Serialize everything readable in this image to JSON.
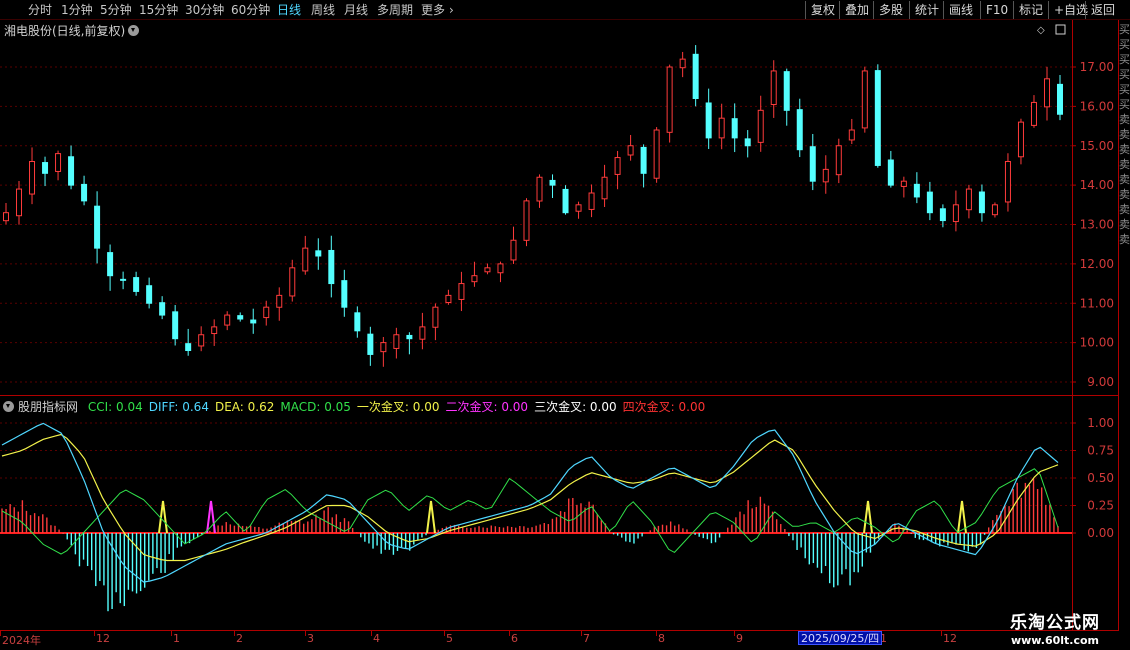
{
  "toolbar": {
    "periods": [
      "分时",
      "1分钟",
      "5分钟",
      "15分钟",
      "30分钟",
      "60分钟",
      "日线",
      "周线",
      "月线",
      "多周期",
      "更多"
    ],
    "active_period": "日线",
    "right_buttons": [
      "复权",
      "叠加",
      "多股",
      "统计",
      "画线",
      "F10",
      "标记",
      "+自选",
      "返回"
    ]
  },
  "stock": {
    "title": "湘电股份(日线,前复权)"
  },
  "price_axis": {
    "ticks": [
      "17.00",
      "16.00",
      "15.00",
      "14.00",
      "13.00",
      "12.00",
      "11.00",
      "10.00",
      "9.00"
    ],
    "values": [
      17,
      16,
      15,
      14,
      13,
      12,
      11,
      10,
      9
    ]
  },
  "indicator": {
    "name": "股朋指标网",
    "items": [
      {
        "label": "CCI: 0.04",
        "color": "#31e04a"
      },
      {
        "label": "DIFF: 0.64",
        "color": "#4fd7ff"
      },
      {
        "label": "DEA: 0.62",
        "color": "#f2f24a"
      },
      {
        "label": "MACD: 0.05",
        "color": "#31e04a"
      },
      {
        "label": "一次金叉: 0.00",
        "color": "#f2f24a"
      },
      {
        "label": "二次金叉: 0.00",
        "color": "#ff33ff"
      },
      {
        "label": "三次金叉: 0.00",
        "color": "#ffffff"
      },
      {
        "label": "四次金叉: 0.00",
        "color": "#ff3333"
      }
    ],
    "ticks": [
      "1.00",
      "0.75",
      "0.50",
      "0.25",
      "0.00"
    ],
    "values": [
      1.0,
      0.75,
      0.5,
      0.25,
      0.0
    ]
  },
  "date_axis": {
    "labels": [
      "2024年",
      "12",
      "1",
      "2",
      "3",
      "4",
      "5",
      "6",
      "7",
      "8",
      "9",
      "1",
      "12"
    ],
    "selected_date": "2025/09/25/四"
  },
  "right_panel": {
    "text": "买买买买买买卖卖卖卖卖卖卖卖卖"
  },
  "watermark": {
    "title": "乐淘公式网",
    "url": "www.60lt.com"
  },
  "colors": {
    "up": "#ff3b3b",
    "down": "#54ffff",
    "axis": "#b00000",
    "grid": "#5a0000",
    "diff": "#4fd7ff",
    "dea": "#f2f24a",
    "cci": "#31e04a"
  },
  "chart_data": [
    {
      "type": "candlestick",
      "title": "湘电股份(日线,前复权)",
      "ylim": [
        9,
        17.5
      ],
      "close_series": [
        13.3,
        13.9,
        14.6,
        14.3,
        14.8,
        14.0,
        13.6,
        12.4,
        11.7,
        11.6,
        11.3,
        11.0,
        10.7,
        10.1,
        9.8,
        10.2,
        10.4,
        10.7,
        10.6,
        10.5,
        10.9,
        11.2,
        11.9,
        12.4,
        12.2,
        11.5,
        10.9,
        10.3,
        9.7,
        10.0,
        10.2,
        10.1,
        10.4,
        10.9,
        11.2,
        11.5,
        11.7,
        11.9,
        12.0,
        12.6,
        13.6,
        14.2,
        14.0,
        13.3,
        13.5,
        13.8,
        14.2,
        14.7,
        15.0,
        14.3,
        15.4,
        17.0,
        17.2,
        16.2,
        15.2,
        15.7,
        15.2,
        15.0,
        15.9,
        16.9,
        15.9,
        14.9,
        14.1,
        14.4,
        15.0,
        15.4,
        16.9,
        14.5,
        14.0,
        14.1,
        13.7,
        13.3,
        13.1,
        13.5,
        13.9,
        13.3,
        13.5,
        14.6,
        15.6,
        16.1,
        16.7,
        15.8
      ]
    },
    {
      "type": "line",
      "title": "股朋指标网",
      "ylim": [
        -0.6,
        1.1
      ],
      "series": [
        {
          "name": "CCI",
          "values": [
            0.2,
            0.1,
            -0.1,
            -0.2,
            0.0,
            0.2,
            0.4,
            0.3,
            0.1,
            -0.1,
            0.0,
            0.2,
            0.0,
            0.3,
            0.4,
            0.2,
            0.1,
            0.0,
            0.3,
            0.4,
            0.2,
            0.35,
            0.2,
            0.3,
            0.2,
            0.5,
            0.35,
            0.2,
            0.1,
            0.25,
            0.0,
            0.3,
            0.1,
            -0.2,
            0.0,
            0.2,
            0.1,
            -0.1,
            0.2,
            0.05,
            0.1,
            0.0,
            0.15,
            0.05,
            -0.1,
            0.2,
            0.3,
            0.0,
            0.1,
            0.4,
            0.5,
            0.6,
            0.05
          ]
        },
        {
          "name": "DIFF",
          "values": [
            0.8,
            0.9,
            1.0,
            0.9,
            0.5,
            0.0,
            -0.3,
            -0.45,
            -0.4,
            -0.3,
            -0.2,
            -0.1,
            -0.05,
            0.0,
            0.1,
            0.2,
            0.35,
            0.3,
            0.1,
            -0.1,
            -0.15,
            -0.05,
            0.05,
            0.1,
            0.15,
            0.2,
            0.25,
            0.35,
            0.6,
            0.7,
            0.5,
            0.4,
            0.5,
            0.6,
            0.5,
            0.4,
            0.6,
            0.85,
            0.95,
            0.7,
            0.3,
            0.0,
            -0.2,
            -0.1,
            0.1,
            0.0,
            -0.1,
            -0.15,
            -0.2,
            0.1,
            0.5,
            0.8,
            0.64
          ]
        },
        {
          "name": "DEA",
          "values": [
            0.7,
            0.75,
            0.85,
            0.9,
            0.7,
            0.3,
            0.0,
            -0.2,
            -0.25,
            -0.25,
            -0.2,
            -0.15,
            -0.08,
            -0.02,
            0.05,
            0.15,
            0.25,
            0.25,
            0.15,
            0.0,
            -0.08,
            -0.05,
            0.02,
            0.07,
            0.12,
            0.17,
            0.22,
            0.3,
            0.45,
            0.55,
            0.5,
            0.45,
            0.48,
            0.55,
            0.5,
            0.45,
            0.55,
            0.7,
            0.85,
            0.75,
            0.45,
            0.2,
            0.0,
            -0.05,
            0.05,
            0.02,
            -0.05,
            -0.1,
            -0.12,
            0.0,
            0.3,
            0.55,
            0.62
          ]
        },
        {
          "name": "MACD",
          "values": [
            0.2,
            0.25,
            0.15,
            0.0,
            -0.3,
            -0.6,
            -0.55,
            -0.5,
            -0.3,
            -0.1,
            0.0,
            0.1,
            0.06,
            0.04,
            0.1,
            0.1,
            0.2,
            0.1,
            -0.1,
            -0.2,
            -0.14,
            0.0,
            0.06,
            0.06,
            0.06,
            0.06,
            0.06,
            0.1,
            0.3,
            0.3,
            0.0,
            -0.1,
            0.04,
            0.1,
            0.0,
            -0.1,
            0.1,
            0.3,
            0.2,
            -0.1,
            -0.3,
            -0.4,
            -0.4,
            -0.1,
            0.1,
            -0.04,
            -0.1,
            -0.1,
            -0.16,
            0.2,
            0.4,
            0.5,
            0.05
          ]
        }
      ]
    }
  ]
}
